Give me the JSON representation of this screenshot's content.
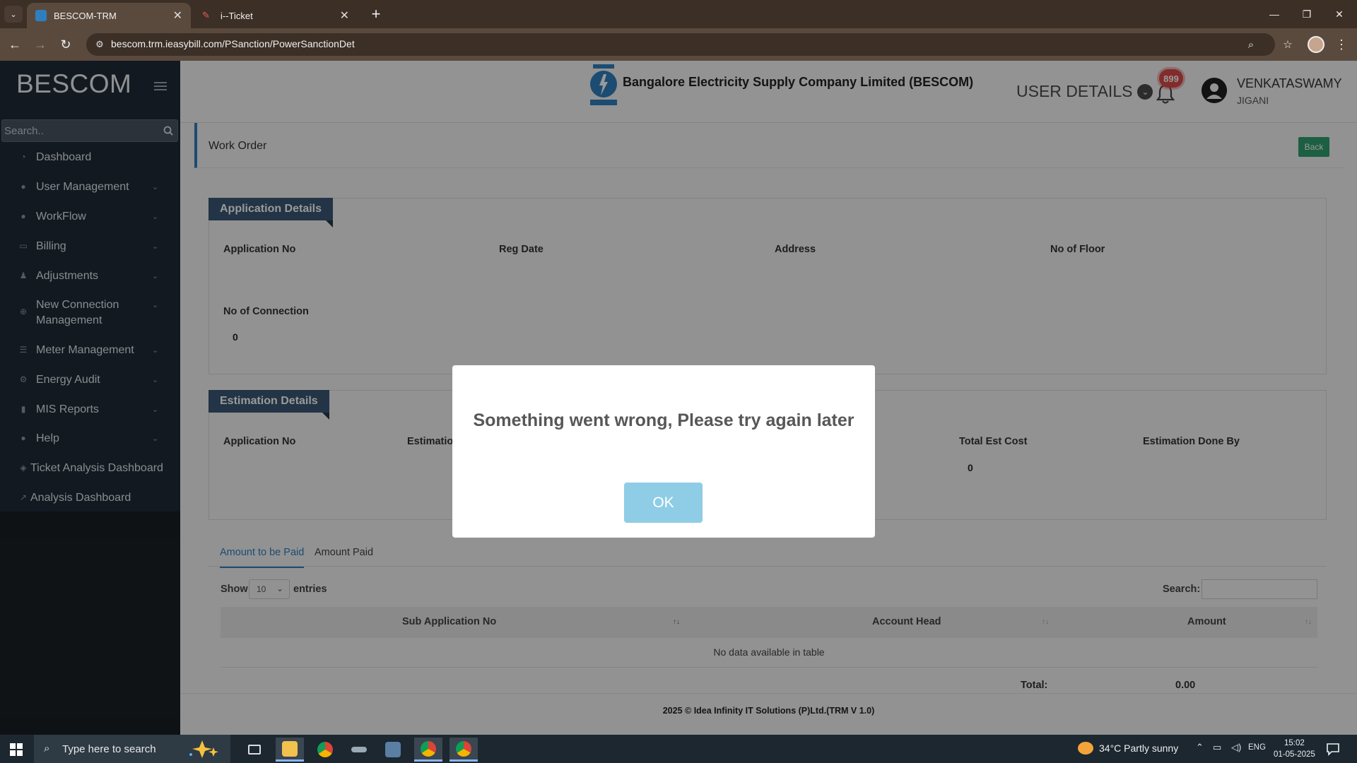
{
  "browser": {
    "tabs": [
      {
        "title": "BESCOM-TRM",
        "favicon": "bescom-favicon"
      },
      {
        "title": "i--Ticket",
        "favicon": "iticket-favicon"
      }
    ],
    "url": "bescom.trm.ieasybill.com/PSanction/PowerSanctionDet"
  },
  "sidebar": {
    "brand": "BESCOM",
    "search_placeholder": "Search..",
    "items": [
      {
        "label": "Dashboard",
        "icon": "dashboard-icon",
        "chevron": false
      },
      {
        "label": "User Management",
        "icon": "user-icon",
        "chevron": true
      },
      {
        "label": "WorkFlow",
        "icon": "user-icon",
        "chevron": true
      },
      {
        "label": "Billing",
        "icon": "monitor-icon",
        "chevron": true
      },
      {
        "label": "Adjustments",
        "icon": "users-icon",
        "chevron": true
      },
      {
        "label": "New Connection Management",
        "icon": "plug-icon",
        "chevron": true
      },
      {
        "label": "Meter Management",
        "icon": "list-icon",
        "chevron": true
      },
      {
        "label": "Energy Audit",
        "icon": "gears-icon",
        "chevron": true
      },
      {
        "label": "MIS Reports",
        "icon": "bar-chart-icon",
        "chevron": true
      },
      {
        "label": "Help",
        "icon": "user-icon",
        "chevron": true
      },
      {
        "label": "Ticket Analysis Dashboard",
        "icon": "diamond-icon",
        "chevron": false
      },
      {
        "label": "Analysis Dashboard",
        "icon": "line-chart-icon",
        "chevron": false
      }
    ]
  },
  "header": {
    "company": "Bangalore Electricity Supply Company Limited (BESCOM)",
    "user_details": "USER DETAILS",
    "notification_count": "899",
    "user_name": "VENKATASWAMY",
    "user_location": "JIGANI"
  },
  "page": {
    "title": "Work Order",
    "back_label": "Back"
  },
  "application_details": {
    "heading": "Application Details",
    "labels": {
      "application_no": "Application No",
      "reg_date": "Reg Date",
      "address": "Address",
      "no_of_floor": "No of Floor",
      "no_of_connection": "No of Connection"
    },
    "values": {
      "no_of_connection": "0"
    }
  },
  "estimation_details": {
    "heading": "Estimation Details",
    "labels": {
      "application_no": "Application No",
      "estimation": "Estimation",
      "total_est_cost": "Total Est Cost",
      "estimation_done_by": "Estimation Done By"
    },
    "values": {
      "total_est_cost": "0"
    }
  },
  "payments": {
    "tabs": [
      "Amount to be Paid",
      "Amount Paid"
    ],
    "show_label": "Show",
    "entries_value": "10",
    "entries_label": "entries",
    "search_label": "Search:",
    "columns": [
      "Sub Application No",
      "Account Head",
      "Amount"
    ],
    "empty_text": "No data available in table",
    "total_label": "Total:",
    "total_value": "0.00"
  },
  "footer": "2025 © Idea Infinity IT Solutions (P)Ltd.(TRM V 1.0)",
  "modal": {
    "message": "Something went wrong, Please try again later",
    "ok_label": "OK",
    "ok_color": "#8fcde6"
  },
  "taskbar": {
    "search_placeholder": "Type here to search",
    "weather": "34°C  Partly sunny",
    "language": "ENG",
    "time": "15:02",
    "date": "01-05-2025"
  }
}
